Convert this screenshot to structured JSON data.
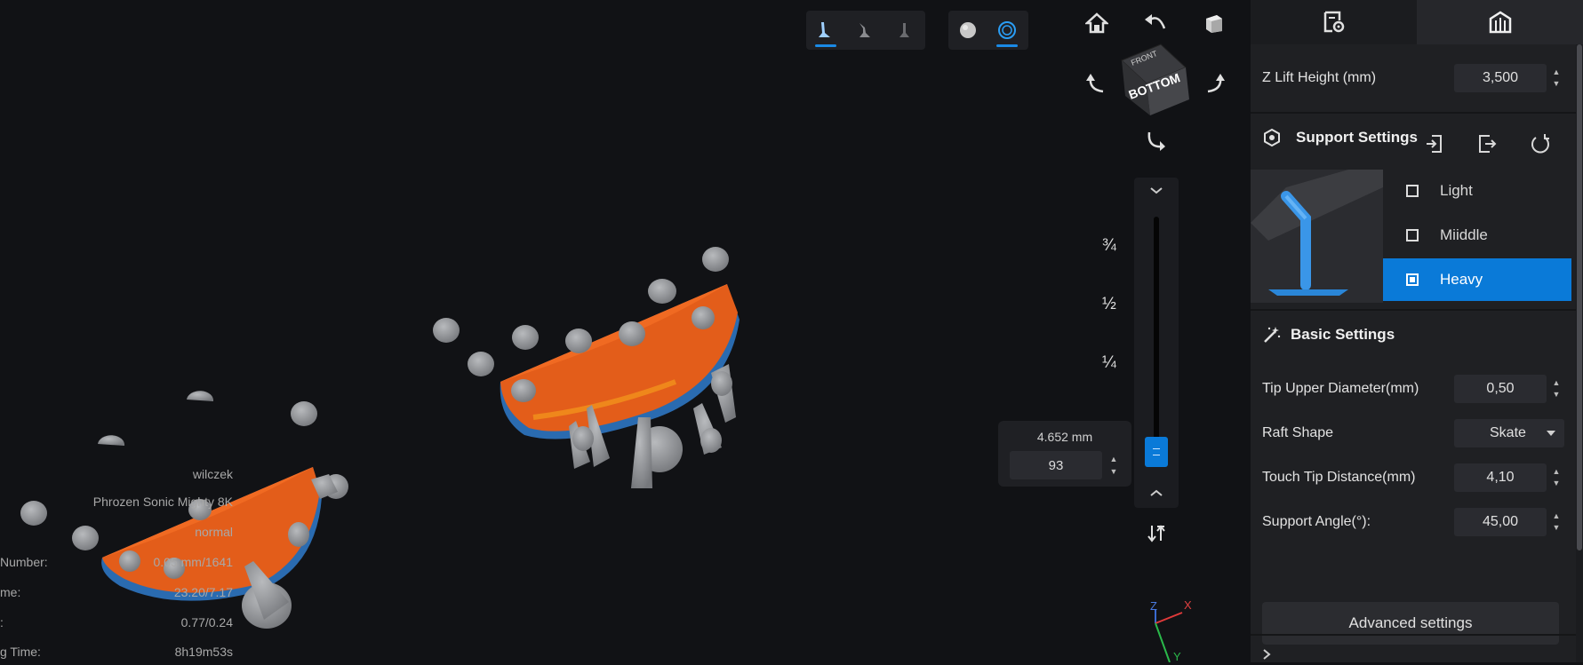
{
  "toolbar": {
    "support_modes": [
      {
        "icon": "support-tip-icon",
        "active": true
      },
      {
        "icon": "support-angled-icon",
        "active": false
      },
      {
        "icon": "support-small-icon",
        "active": false
      }
    ],
    "view_modes": [
      {
        "icon": "solid-sphere-icon",
        "active": false
      },
      {
        "icon": "wireframe-sphere-icon",
        "active": true
      }
    ]
  },
  "view_controls": {
    "home_icon": "home-icon",
    "undo_view_icon": "rotate-back-icon",
    "cube_view_icon": "cube-icon",
    "cube": {
      "top_face": "FRONT",
      "front_face": "BOTTOM"
    }
  },
  "layer_slider": {
    "fractions": [
      "¾",
      "½",
      "¼"
    ],
    "height_readout": "4.652 mm",
    "layer_value": "93",
    "level_fraction": 0.06
  },
  "print_info": {
    "values": [
      "wilczek",
      "Phrozen Sonic Mighty 8K",
      "normal",
      "0.05 mm/1641",
      "23.20/7.17",
      "0.77/0.24",
      "8h19m53s"
    ],
    "labels": [
      "Number:",
      "me:",
      ":",
      "g Time:"
    ]
  },
  "axis": {
    "z": "Z",
    "x": "X",
    "y": "Y"
  },
  "panel": {
    "tabs": [
      {
        "icon": "print-settings-icon",
        "active": false
      },
      {
        "icon": "support-structure-icon",
        "active": true
      }
    ],
    "z_lift": {
      "label": "Z Lift Height (mm)",
      "value": "3,500"
    },
    "support_settings": {
      "title": "Support Settings",
      "options": [
        {
          "label": "Light",
          "selected": false
        },
        {
          "label": "Miiddle",
          "selected": false
        },
        {
          "label": "Heavy",
          "selected": true
        }
      ]
    },
    "basic_settings": {
      "title": "Basic Settings",
      "tip_upper_diameter": {
        "label": "Tip Upper Diameter(mm)",
        "value": "0,50"
      },
      "raft_shape": {
        "label": "Raft Shape",
        "value": "Skate"
      },
      "touch_tip_distance": {
        "label": "Touch Tip Distance(mm)",
        "value": "4,10"
      },
      "support_angle": {
        "label": "Support Angle(°):",
        "value": "45,00"
      }
    },
    "advanced_button": "Advanced settings"
  },
  "colors": {
    "accent": "#1a8ae6",
    "model_orange": "#e35d1a",
    "support_gray": "#9a9ca0",
    "background": "#111215"
  }
}
